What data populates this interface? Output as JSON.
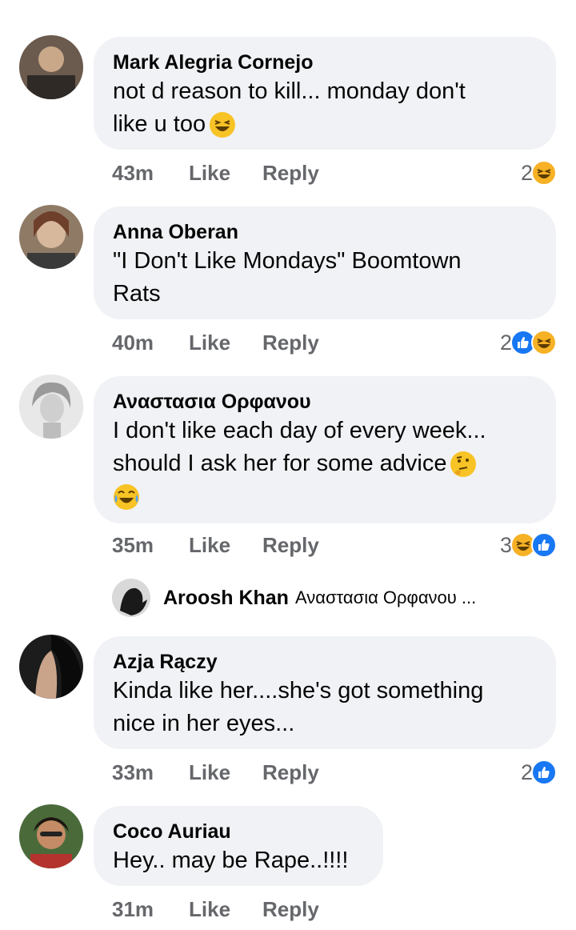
{
  "comments": [
    {
      "author": "Mark Alegria Cornejo",
      "text_lines": [
        "not d reason to kill... monday don't",
        "like u too"
      ],
      "time": "43m",
      "like_label": "Like",
      "reply_label": "Reply",
      "reaction_count": "2",
      "reactions": [
        "haha-icon"
      ]
    },
    {
      "author": "Anna Oberan",
      "text_lines": [
        "\"I Don't Like Mondays\" Boomtown",
        "Rats"
      ],
      "time": "40m",
      "like_label": "Like",
      "reply_label": "Reply",
      "reaction_count": "2",
      "reactions": [
        "like-icon",
        "haha-icon"
      ]
    },
    {
      "author": "Αναστασια Ορφανου",
      "text_lines": [
        "I don't like each day of every week...",
        "should I ask her for some advice"
      ],
      "time": "35m",
      "like_label": "Like",
      "reply_label": "Reply",
      "reaction_count": "3",
      "reactions": [
        "haha-icon",
        "like-icon"
      ]
    },
    {
      "author": "Azja Rączy",
      "text_lines": [
        "Kinda like her....she's got something",
        "nice in her eyes..."
      ],
      "time": "33m",
      "like_label": "Like",
      "reply_label": "Reply",
      "reaction_count": "2",
      "reactions": [
        "like-icon"
      ]
    },
    {
      "author": "Coco Auriau",
      "text_lines": [
        "Hey.. may be Rape..!!!!"
      ],
      "time": "31m",
      "like_label": "Like",
      "reply_label": "Reply",
      "reaction_count": "",
      "reactions": []
    }
  ],
  "reply_preview": {
    "name": "Aroosh Khan",
    "snippet": "Αναστασια Ορφανου ..."
  },
  "colors": {
    "bubble": "#f0f2f5",
    "meta": "#65676b",
    "like": "#1877f2",
    "haha": "#f7b125"
  }
}
